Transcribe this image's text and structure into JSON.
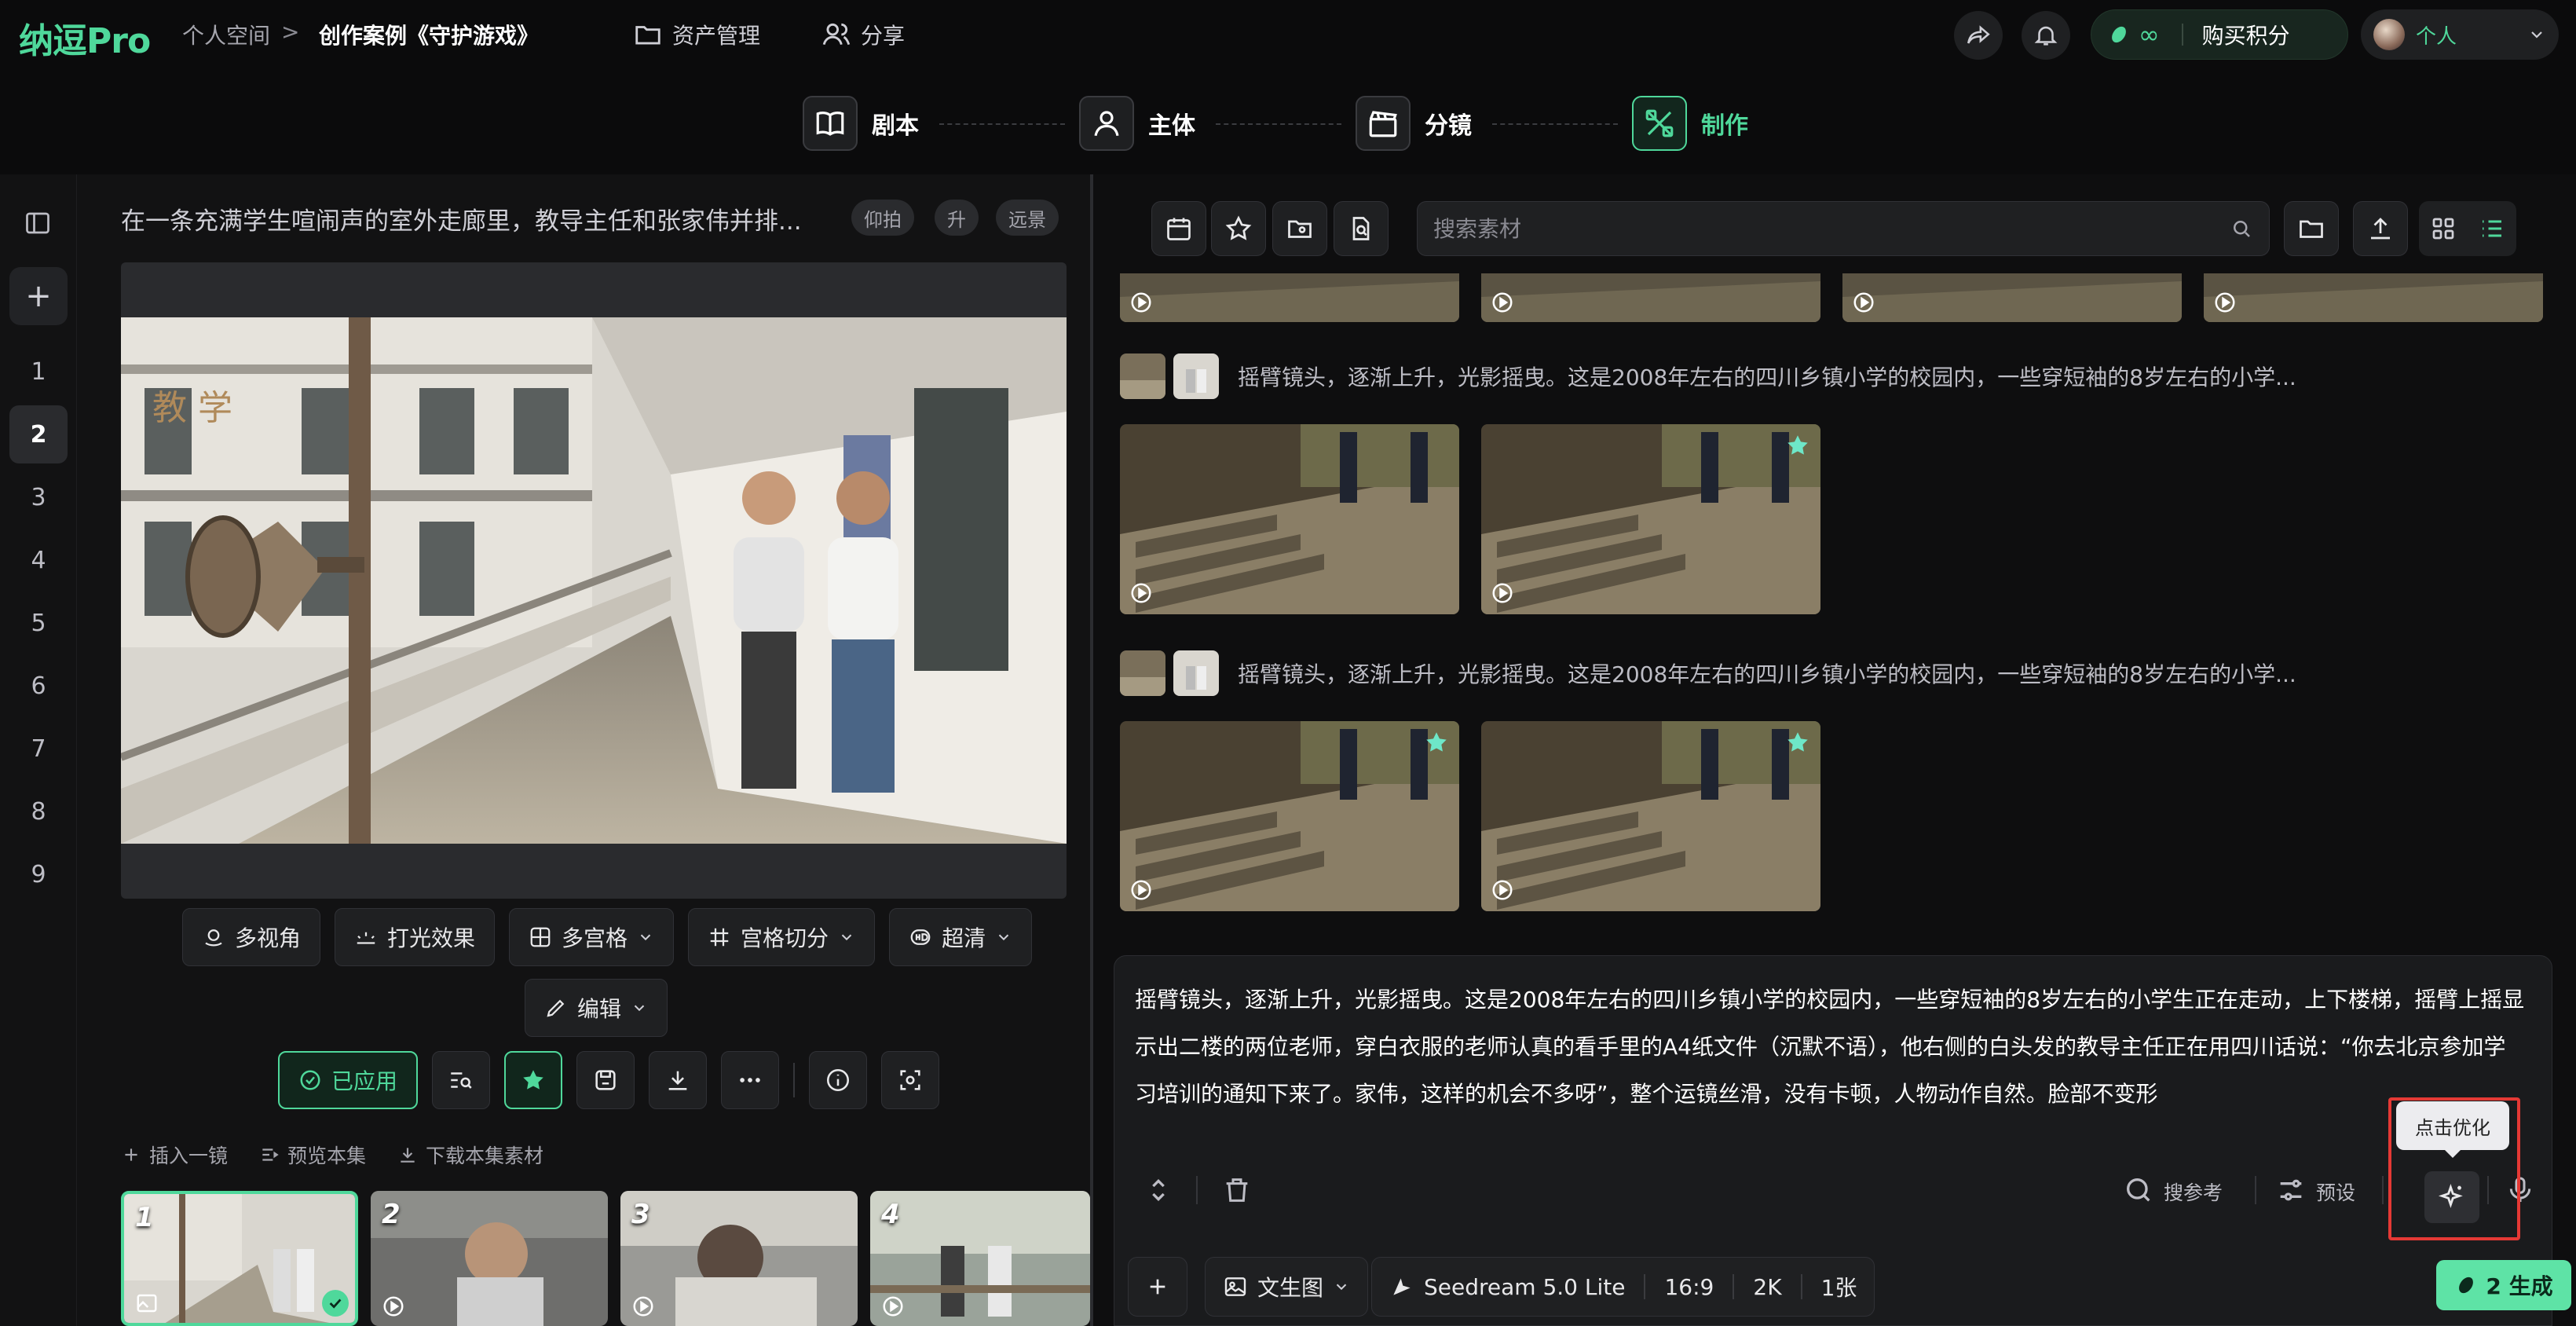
{
  "app": {
    "logo_main": "纳逗",
    "logo_suffix": "Pro",
    "breadcrumb_root": "个人空间",
    "breadcrumb_sep": ">",
    "breadcrumb_current": "创作案例《守护游戏》"
  },
  "topnav": {
    "assets_label": "资产管理",
    "share_label": "分享",
    "credits_value": "∞",
    "buy_label": "购买积分",
    "user_label": "个人"
  },
  "steps": [
    {
      "label": "剧本",
      "icon": "book-icon"
    },
    {
      "label": "主体",
      "icon": "person-icon"
    },
    {
      "label": "分镜",
      "icon": "clapper-icon"
    },
    {
      "label": "制作",
      "icon": "tools-icon"
    }
  ],
  "active_step": "制作",
  "sidebar": {
    "add_label": "+",
    "scenes": [
      "1",
      "2",
      "3",
      "4",
      "5",
      "6",
      "7",
      "8",
      "9"
    ],
    "active_scene": "2"
  },
  "left": {
    "prompt_title": "在一条充满学生喧闹声的室外走廊里，教导主任和张家伟并排...",
    "tags": [
      "仰拍",
      "升",
      "远景"
    ],
    "tools_row1": [
      {
        "label": "多视角",
        "icon": "multiview-icon",
        "dropdown": false
      },
      {
        "label": "打光效果",
        "icon": "light-icon",
        "dropdown": false
      },
      {
        "label": "多宫格",
        "icon": "grid-icon",
        "dropdown": true
      },
      {
        "label": "宫格切分",
        "icon": "hash-icon",
        "dropdown": true
      },
      {
        "label": "超清",
        "icon": "hd-icon",
        "dropdown": true
      }
    ],
    "edit_label": "编辑",
    "applied_label": "已应用",
    "links": [
      {
        "label": "插入一镜",
        "icon": "plus-icon"
      },
      {
        "label": "预览本集",
        "icon": "list-icon"
      },
      {
        "label": "下载本集素材",
        "icon": "download-icon"
      }
    ],
    "thumbs": [
      "1",
      "2",
      "3",
      "4"
    ]
  },
  "right": {
    "search_placeholder": "搜索素材",
    "group_text": "摇臂镜头，逐渐上升，光影摇曳。这是2008年左右的四川乡镇小学的校园内，一些穿短袖的8岁左右的小学...",
    "editor_text": "摇臂镜头，逐渐上升，光影摇曳。这是2008年左右的四川乡镇小学的校园内，一些穿短袖的8岁左右的小学生正在走动，上下楼梯，摇臂上摇显示出二楼的两位老师，穿白衣服的老师认真的看手里的A4纸文件（沉默不语），他右侧的白头发的教导主任正在用四川话说：“你去北京参加学习培训的通知下来了。家伟，这样的机会不多呀”，整个运镜丝滑，没有卡顿，人物动作自然。脸部不变形",
    "ref_label": "搜参考",
    "preset_label": "预设",
    "tooltip": "点击优化",
    "mode_label": "文生图",
    "model_label": "Seedream 5.0 Lite",
    "ratio": "16:9",
    "resolution": "2K",
    "count": "1张",
    "generate_label": "2 生成"
  },
  "colors": {
    "accent": "#4fd89b",
    "background": "#0b0b0c",
    "panel": "#121213",
    "highlight": "#e53935"
  }
}
